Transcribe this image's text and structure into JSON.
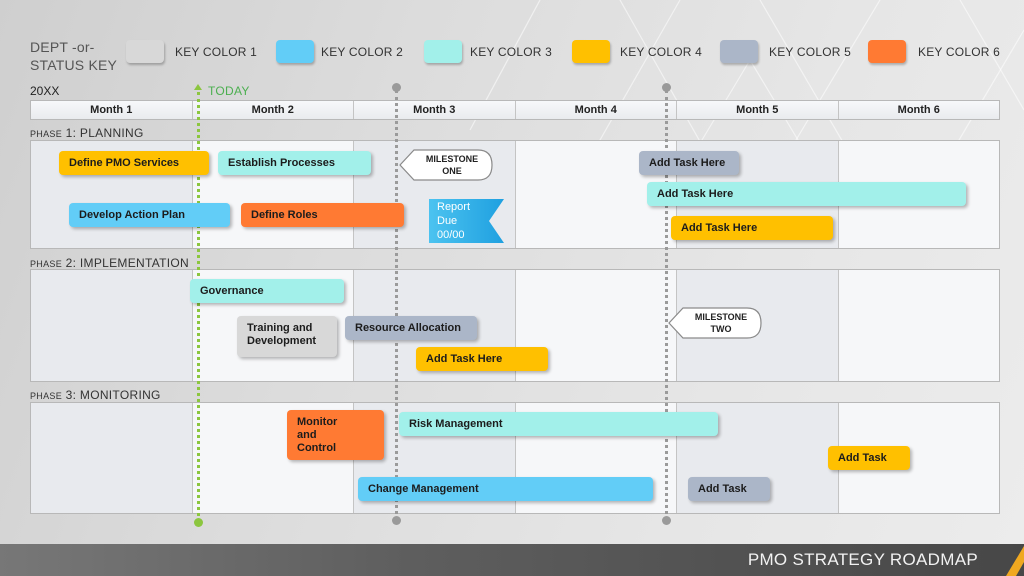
{
  "key": {
    "title_line1": "DEPT -or-",
    "title_line2": "STATUS KEY",
    "items": [
      {
        "label": "KEY COLOR 1",
        "color": "#d8d8d8"
      },
      {
        "label": "KEY COLOR 2",
        "color": "#62cdf7"
      },
      {
        "label": "KEY COLOR 3",
        "color": "#a2f0ea"
      },
      {
        "label": "KEY COLOR 4",
        "color": "#ffc000"
      },
      {
        "label": "KEY COLOR 5",
        "color": "#abb6c8"
      },
      {
        "label": "KEY COLOR 6",
        "color": "#ff7a33"
      }
    ]
  },
  "timeline": {
    "year": "20XX",
    "today_label": "TODAY",
    "today_color": "#8cc63f",
    "marker_color": "#9a9a9a",
    "months": [
      "Month 1",
      "Month 2",
      "Month 3",
      "Month 4",
      "Month 5",
      "Month 6"
    ]
  },
  "phases": [
    {
      "prefix": "PHASE",
      "number": "1:",
      "name": "PLANNING",
      "tasks": [
        {
          "label": "Define PMO Services",
          "key": 4
        },
        {
          "label": "Establish Processes",
          "key": 3
        },
        {
          "label": "Develop Action Plan",
          "key": 2
        },
        {
          "label": "Define Roles",
          "key": 6
        },
        {
          "label": "Add Task Here",
          "key": 5
        },
        {
          "label": "Add Task Here",
          "key": 3
        },
        {
          "label": "Add Task Here",
          "key": 4
        }
      ],
      "milestone": {
        "line1": "MILESTONE",
        "line2": "ONE"
      },
      "report": {
        "line1": "Report",
        "line2": "Due",
        "line3": "00/00",
        "color": "#29abe2"
      }
    },
    {
      "prefix": "PHASE",
      "number": "2:",
      "name": "IMPLEMENTATION",
      "tasks": [
        {
          "label": "Governance",
          "key": 3
        },
        {
          "label": "Training and Development",
          "key": 1
        },
        {
          "label": "Resource Allocation",
          "key": 5
        },
        {
          "label": "Add Task Here",
          "key": 4
        }
      ],
      "milestone": {
        "line1": "MILESTONE",
        "line2": "TWO"
      }
    },
    {
      "prefix": "PHASE",
      "number": "3:",
      "name": "MONITORING",
      "tasks": [
        {
          "label": "Monitor and Control",
          "key": 6
        },
        {
          "label": "Risk Management",
          "key": 3
        },
        {
          "label": "Add Task",
          "key": 4
        },
        {
          "label": "Change Management",
          "key": 2
        },
        {
          "label": "Add Task",
          "key": 5
        }
      ]
    }
  ],
  "footer": {
    "title": "PMO STRATEGY ROADMAP",
    "accent": "#f0a820"
  }
}
